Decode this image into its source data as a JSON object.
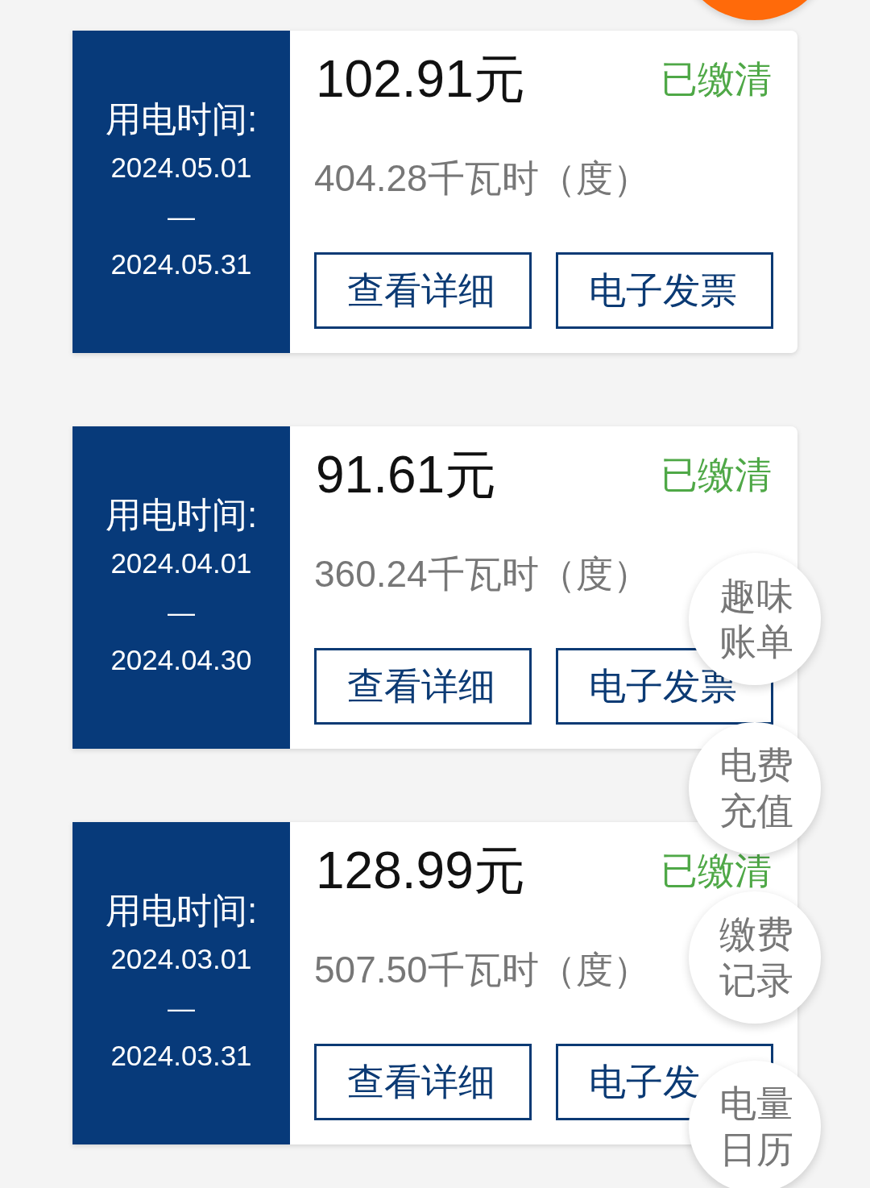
{
  "bills": [
    {
      "period_label": "用电时间:",
      "start_date": "2024.05.01",
      "separator": "—",
      "end_date": "2024.05.31",
      "amount": "102.91元",
      "status": "已缴清",
      "usage": "404.28千瓦时（度）",
      "buttons": [
        {
          "label": "查看详细"
        },
        {
          "label": "电子发票"
        }
      ]
    },
    {
      "period_label": "用电时间:",
      "start_date": "2024.04.01",
      "separator": "—",
      "end_date": "2024.04.30",
      "amount": "91.61元",
      "status": "已缴清",
      "usage": "360.24千瓦时（度）",
      "buttons": [
        {
          "label": "查看详细"
        },
        {
          "label": "电子发票"
        }
      ]
    },
    {
      "period_label": "用电时间:",
      "start_date": "2024.03.01",
      "separator": "—",
      "end_date": "2024.03.31",
      "amount": "128.99元",
      "status": "已缴清",
      "usage": "507.50千瓦时（度）",
      "buttons": [
        {
          "label": "查看详细"
        },
        {
          "label": "电子发"
        }
      ]
    }
  ],
  "floating_menu": [
    {
      "label": "趣味账单"
    },
    {
      "label": "电费充值"
    },
    {
      "label": "缴费记录"
    },
    {
      "label": "电量日历"
    }
  ]
}
